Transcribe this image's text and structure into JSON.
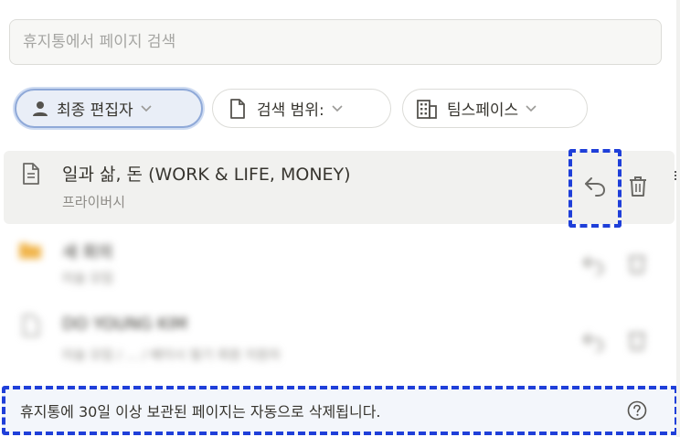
{
  "search": {
    "placeholder": "휴지통에서 페이지 검색",
    "value": ""
  },
  "filters": {
    "editor": {
      "label": "최종 편집자",
      "icon": "person-icon"
    },
    "scope": {
      "label": "검색 범위:",
      "icon": "page-icon"
    },
    "space": {
      "label": "팀스페이스",
      "icon": "building-icon"
    }
  },
  "items": [
    {
      "title": "일과 삶, 돈 (WORK & LIFE, MONEY)",
      "subtitle": "프라이버시",
      "icon": "document-icon"
    },
    {
      "title": "새 회의",
      "subtitle": "미술 모임",
      "icon": "folder-icon"
    },
    {
      "title": "DO YOUNG KIM",
      "subtitle": "미술 모임 / ... / 베이시 필기 회원 지원자",
      "icon": "page-icon"
    }
  ],
  "footer": {
    "text": "휴지통에 30일 이상 보관된 페이지는 자동으로 삭제됩니다."
  },
  "colors": {
    "annotation": "#1f3fd9",
    "chip_active_bg": "#e9eef7"
  }
}
